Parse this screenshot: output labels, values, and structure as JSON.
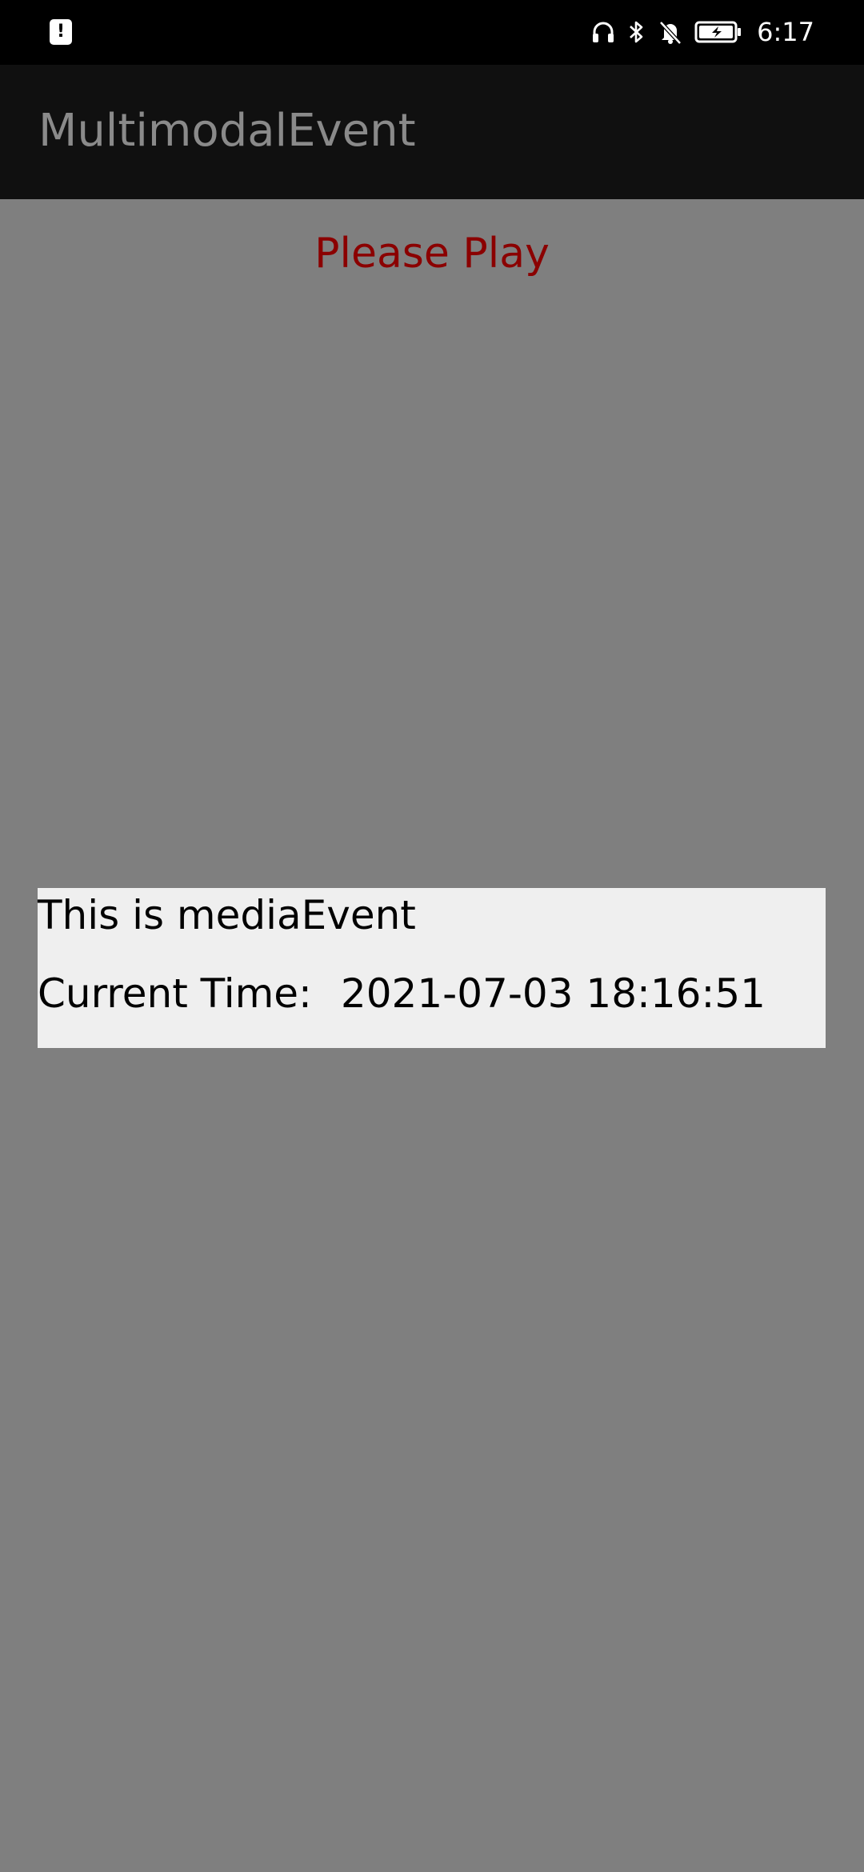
{
  "status_bar": {
    "alert_icon": "alert-icon",
    "icons": [
      "headphones-icon",
      "bluetooth-icon",
      "bell-muted-icon",
      "battery-charging-icon"
    ],
    "time": "6:17"
  },
  "app_bar": {
    "title": "MultimodalEvent"
  },
  "main": {
    "please_play": "Please Play",
    "event": {
      "line1": "This is mediaEvent",
      "time_label": "Current Time:",
      "time_value": "2021-07-03 18:16:51"
    }
  },
  "colors": {
    "background": "#7f7f7f",
    "app_bar": "#101010",
    "status_bar": "#000000",
    "accent_text": "#8b0000",
    "card": "#efefef"
  }
}
